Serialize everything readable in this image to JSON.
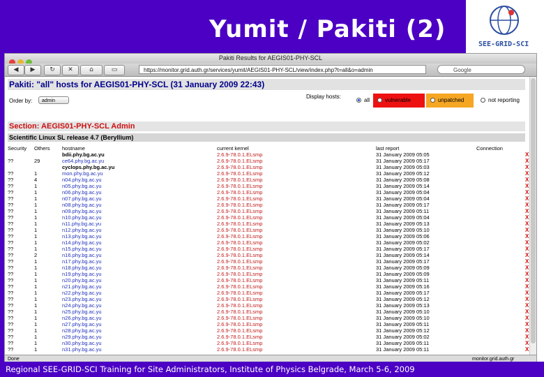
{
  "slide": {
    "title": "Yumit / Pakiti (2)",
    "logo_text": "SEE-GRID-SCI",
    "footer": "Regional SEE-GRID-SCI Training for Site Administrators, Institute of Physics Belgrade, March 5-6, 2009"
  },
  "browser": {
    "window_title": "Pakiti Results for AEGIS01-PHY-SCL",
    "url": "https://monitor.grid.auth.gr/services/yumit/AEGIS01-PHY-SCL/view/index.php?t=all&o=admin",
    "search_placeholder": "Google",
    "status_left": "Done",
    "status_right": "monitor.grid.auth.gr"
  },
  "page": {
    "title": "Pakiti: \"all\" hosts for AEGIS01-PHY-SCL (31 January 2009 22:43)",
    "order_label": "Order by:",
    "order_value": "admin",
    "display_label": "Display hosts:",
    "filters": [
      {
        "label": "all",
        "selected": true,
        "color": "#ffffff"
      },
      {
        "label": "vulnerable",
        "selected": false,
        "color": "#ee1111"
      },
      {
        "label": "unpatched",
        "selected": false,
        "color": "#f5a623"
      },
      {
        "label": "not reporting",
        "selected": false,
        "color": "#ffffff"
      }
    ],
    "section": "Section: AEGIS01-PHY-SCL Admin",
    "subsection": "Scientific Linux SL release 4.7 (Beryllium)",
    "columns": [
      "Security",
      "Others",
      "hostname",
      "current kernel",
      "last report",
      "Connection"
    ],
    "rows": [
      {
        "security": "",
        "others": "",
        "hostname": "bdii.phy.bg.ac.yu",
        "link": false,
        "kernel": "2.6.9-78.0.1.ELsmp",
        "report": "31 January 2009 05:05"
      },
      {
        "security": "??",
        "others": "29",
        "hostname": "ce64.phy.bg.ac.yu",
        "link": true,
        "kernel": "2.6.9-78.0.1.ELsmp",
        "report": "31 January 2009 05:17"
      },
      {
        "security": "",
        "others": "",
        "hostname": "cyclops.phy.bg.ac.yu",
        "link": false,
        "kernel": "2.6.9-78.0.1.ELsmp",
        "report": "31 January 2009 05:03"
      },
      {
        "security": "??",
        "others": "1",
        "hostname": "mon.phy.bg.ac.yu",
        "link": true,
        "kernel": "2.6.9-78.0.1.ELsmp",
        "report": "31 January 2009 05:12"
      },
      {
        "security": "??",
        "others": "4",
        "hostname": "n04.phy.bg.ac.yu",
        "link": true,
        "kernel": "2.6.9-78.0.1.ELsmp",
        "report": "31 January 2009 05:08"
      },
      {
        "security": "??",
        "others": "1",
        "hostname": "n05.phy.bg.ac.yu",
        "link": true,
        "kernel": "2.6.9-78.0.1.ELsmp",
        "report": "31 January 2009 05:14"
      },
      {
        "security": "??",
        "others": "1",
        "hostname": "n06.phy.bg.ac.yu",
        "link": true,
        "kernel": "2.6.9-78.0.1.ELsmp",
        "report": "31 January 2009 05:04"
      },
      {
        "security": "??",
        "others": "1",
        "hostname": "n07.phy.bg.ac.yu",
        "link": true,
        "kernel": "2.6.9-78.0.1.ELsmp",
        "report": "31 January 2009 05:04"
      },
      {
        "security": "??",
        "others": "1",
        "hostname": "n08.phy.bg.ac.yu",
        "link": true,
        "kernel": "2.6.9-78.0.1.ELsmp",
        "report": "31 January 2009 05:17"
      },
      {
        "security": "??",
        "others": "1",
        "hostname": "n09.phy.bg.ac.yu",
        "link": true,
        "kernel": "2.6.9-78.0.1.ELsmp",
        "report": "31 January 2009 05:11"
      },
      {
        "security": "??",
        "others": "1",
        "hostname": "n10.phy.bg.ac.yu",
        "link": true,
        "kernel": "2.6.9-78.0.1.ELsmp",
        "report": "31 January 2009 05:04"
      },
      {
        "security": "??",
        "others": "1",
        "hostname": "n11.phy.bg.ac.yu",
        "link": true,
        "kernel": "2.6.9-78.0.1.ELsmp",
        "report": "31 January 2009 05:13"
      },
      {
        "security": "??",
        "others": "1",
        "hostname": "n12.phy.bg.ac.yu",
        "link": true,
        "kernel": "2.6.9-78.0.1.ELsmp",
        "report": "31 January 2009 05:10"
      },
      {
        "security": "??",
        "others": "1",
        "hostname": "n13.phy.bg.ac.yu",
        "link": true,
        "kernel": "2.6.9-78.0.1.ELsmp",
        "report": "31 January 2009 05:06"
      },
      {
        "security": "??",
        "others": "1",
        "hostname": "n14.phy.bg.ac.yu",
        "link": true,
        "kernel": "2.6.9-78.0.1.ELsmp",
        "report": "31 January 2009 05:02"
      },
      {
        "security": "??",
        "others": "1",
        "hostname": "n15.phy.bg.ac.yu",
        "link": true,
        "kernel": "2.6.9-78.0.1.ELsmp",
        "report": "31 January 2009 05:17"
      },
      {
        "security": "??",
        "others": "2",
        "hostname": "n16.phy.bg.ac.yu",
        "link": true,
        "kernel": "2.6.9-78.0.1.ELsmp",
        "report": "31 January 2009 05:14"
      },
      {
        "security": "??",
        "others": "1",
        "hostname": "n17.phy.bg.ac.yu",
        "link": true,
        "kernel": "2.6.9-78.0.1.ELsmp",
        "report": "31 January 2009 05:17"
      },
      {
        "security": "??",
        "others": "1",
        "hostname": "n18.phy.bg.ac.yu",
        "link": true,
        "kernel": "2.6.9-78.0.1.ELsmp",
        "report": "31 January 2009 05:09"
      },
      {
        "security": "??",
        "others": "1",
        "hostname": "n19.phy.bg.ac.yu",
        "link": true,
        "kernel": "2.6.9-78.0.1.ELsmp",
        "report": "31 January 2009 05:09"
      },
      {
        "security": "??",
        "others": "1",
        "hostname": "n20.phy.bg.ac.yu",
        "link": true,
        "kernel": "2.6.9-78.0.1.ELsmp",
        "report": "31 January 2009 05:11"
      },
      {
        "security": "??",
        "others": "1",
        "hostname": "n21.phy.bg.ac.yu",
        "link": true,
        "kernel": "2.6.9-78.0.1.ELsmp",
        "report": "31 January 2009 05:16"
      },
      {
        "security": "??",
        "others": "1",
        "hostname": "n22.phy.bg.ac.yu",
        "link": true,
        "kernel": "2.6.9-78.0.1.ELsmp",
        "report": "31 January 2009 05:17"
      },
      {
        "security": "??",
        "others": "1",
        "hostname": "n23.phy.bg.ac.yu",
        "link": true,
        "kernel": "2.6.9-78.0.1.ELsmp",
        "report": "31 January 2009 05:12"
      },
      {
        "security": "??",
        "others": "1",
        "hostname": "n24.phy.bg.ac.yu",
        "link": true,
        "kernel": "2.6.9-78.0.1.ELsmp",
        "report": "31 January 2009 05:13"
      },
      {
        "security": "??",
        "others": "1",
        "hostname": "n25.phy.bg.ac.yu",
        "link": true,
        "kernel": "2.6.9-78.0.1.ELsmp",
        "report": "31 January 2009 05:10"
      },
      {
        "security": "??",
        "others": "1",
        "hostname": "n26.phy.bg.ac.yu",
        "link": true,
        "kernel": "2.6.9-78.0.1.ELsmp",
        "report": "31 January 2009 05:10"
      },
      {
        "security": "??",
        "others": "1",
        "hostname": "n27.phy.bg.ac.yu",
        "link": true,
        "kernel": "2.6.9-78.0.1.ELsmp",
        "report": "31 January 2009 05:11"
      },
      {
        "security": "??",
        "others": "1",
        "hostname": "n28.phy.bg.ac.yu",
        "link": true,
        "kernel": "2.6.9-78.0.1.ELsmp",
        "report": "31 January 2009 05:12"
      },
      {
        "security": "??",
        "others": "1",
        "hostname": "n29.phy.bg.ac.yu",
        "link": true,
        "kernel": "2.6.9-78.0.1.ELsmp",
        "report": "31 January 2009 05:02"
      },
      {
        "security": "??",
        "others": "1",
        "hostname": "n30.phy.bg.ac.yu",
        "link": true,
        "kernel": "2.6.9-78.0.1.ELsmp",
        "report": "31 January 2009 05:11"
      },
      {
        "security": "??",
        "others": "1",
        "hostname": "n31.phy.bg.ac.yu",
        "link": true,
        "kernel": "2.6.9-78.0.1.ELsmp",
        "report": "31 January 2009 05:11"
      }
    ]
  },
  "colors": {
    "banner": "#4b00c4",
    "kernel": "#c01818",
    "link": "#2233bb"
  }
}
